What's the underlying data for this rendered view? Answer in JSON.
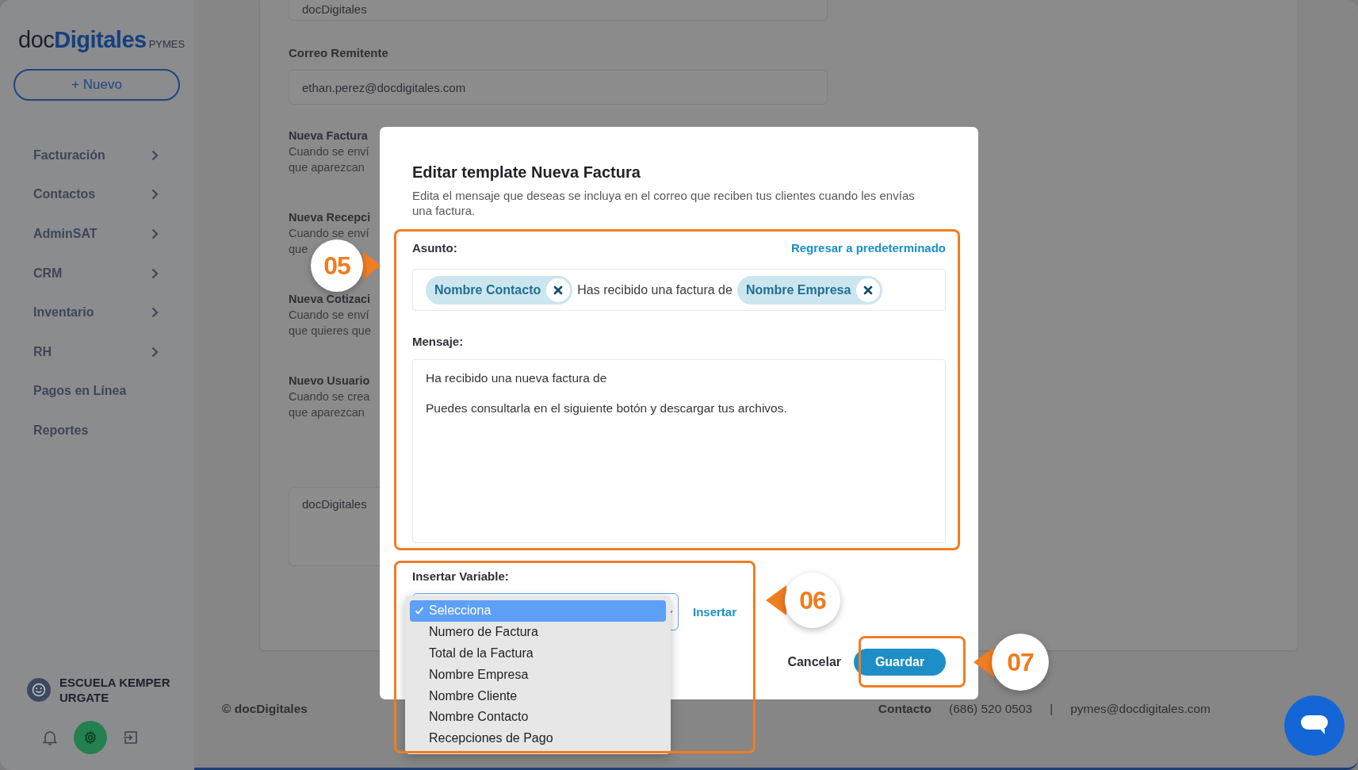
{
  "sidebar": {
    "logo": "doc**Digitales**",
    "logo_suffix": "PYMES",
    "new_button": "+ Nuevo",
    "items": [
      {
        "label": "Facturación",
        "expandable": true
      },
      {
        "label": "Contactos",
        "expandable": true
      },
      {
        "label": "AdminSAT",
        "expandable": true
      },
      {
        "label": "CRM",
        "expandable": true
      },
      {
        "label": "Inventario",
        "expandable": true
      },
      {
        "label": "RH",
        "expandable": true
      },
      {
        "label": "Pagos en Línea",
        "expandable": false
      },
      {
        "label": "Reportes",
        "expandable": false
      }
    ],
    "user": {
      "name": "ESCUELA KEMPER URGATE"
    },
    "bottom_icons": [
      {
        "kind": "bell",
        "selected": false
      },
      {
        "kind": "gear",
        "selected": true
      },
      {
        "kind": "logout",
        "selected": false
      }
    ]
  },
  "settings_form": {
    "top_field_value": "docDigitales",
    "sender_label": "Correo Remitente",
    "sender_value": "ethan.perez@docdigitales.com",
    "templates": [
      {
        "title": "Nueva Factura",
        "lines": [
          "Cuando se enví",
          "que aparezcan"
        ]
      },
      {
        "title": "Nueva Recepci",
        "lines": [
          "Cuando se enví",
          "que"
        ]
      },
      {
        "title": "Nueva Cotizaci",
        "lines": [
          "Cuando se enví",
          "que quieres que"
        ]
      },
      {
        "title": "Nuevo Usuario",
        "lines": [
          "Cuando se crea",
          "que aparezcan"
        ]
      }
    ],
    "footer_field_value": "docDigitales"
  },
  "footer": {
    "copyright": "© docDigitales",
    "contact_label": "Contacto",
    "phone": "(686) 520 0503",
    "separator": "|",
    "email": "pymes@docdigitales.com"
  },
  "modal": {
    "title": "Editar template Nueva Factura",
    "description": "Edita el mensaje que deseas se incluya en el correo que reciben tus clientes cuando les envías una factura.",
    "subject_label": "Asunto:",
    "reset_link": "Regresar a predeterminado",
    "subject": [
      {
        "kind": "chip",
        "text": "Nombre Contacto"
      },
      {
        "kind": "text",
        "text": "Has recibido una factura de"
      },
      {
        "kind": "chip",
        "text": "Nombre Empresa"
      }
    ],
    "message_label": "Mensaje:",
    "message": [
      "Ha recibido una nueva factura de",
      "Puedes consultarla en el siguiente botón y descargar tus archivos."
    ],
    "variable_label": "Insertar Variable:",
    "insert_link": "Insertar",
    "cancel_button": "Cancelar",
    "save_button": "Guardar"
  },
  "variable_dropdown": {
    "options": [
      {
        "label": "Selecciona",
        "selected": true
      },
      {
        "label": "Numero de Factura",
        "selected": false
      },
      {
        "label": "Total de la Factura",
        "selected": false
      },
      {
        "label": "Nombre Empresa",
        "selected": false
      },
      {
        "label": "Nombre Cliente",
        "selected": false
      },
      {
        "label": "Nombre Contacto",
        "selected": false
      },
      {
        "label": "Recepciones de Pago",
        "selected": false
      }
    ]
  },
  "callouts": [
    {
      "label": "05"
    },
    {
      "label": "06"
    },
    {
      "label": "07"
    }
  ]
}
